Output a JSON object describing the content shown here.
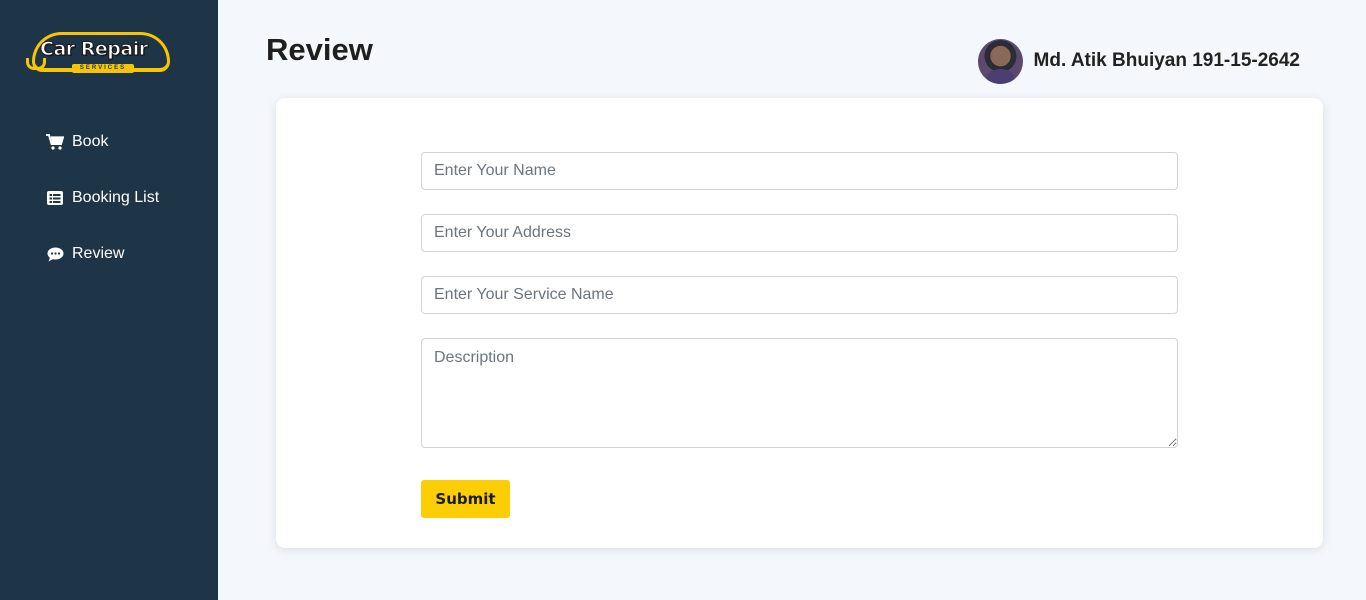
{
  "brand": {
    "name": "Car Repair",
    "tagline": "SERVICES"
  },
  "sidebar": {
    "items": [
      {
        "label": "Book",
        "icon": "cart-icon"
      },
      {
        "label": "Booking List",
        "icon": "list-icon"
      },
      {
        "label": "Review",
        "icon": "comment-icon"
      }
    ]
  },
  "header": {
    "title": "Review"
  },
  "user": {
    "name": "Md. Atik Bhuiyan 191-15-2642",
    "avatar": "user-avatar"
  },
  "form": {
    "name_placeholder": "Enter Your Name",
    "address_placeholder": "Enter Your Address",
    "service_placeholder": "Enter Your Service Name",
    "description_placeholder": "Description",
    "submit_label": "Submit"
  },
  "colors": {
    "sidebar": "#1e3447",
    "background": "#f4f7fc",
    "accent": "#fccf04"
  }
}
